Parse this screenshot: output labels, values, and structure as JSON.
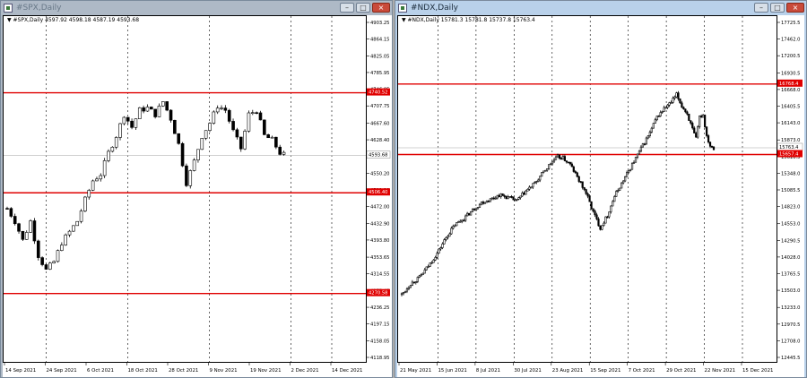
{
  "windows": [
    {
      "title": "#SPX,Daily",
      "active": false,
      "header": "#SPX,Daily  4597.92 4598.18 4587.19 4593.68",
      "buttons": {
        "minimize": "–",
        "maximize": "□",
        "close": "×"
      },
      "colors": {
        "level_line": "#e00000",
        "price_line": "#c0c0c0",
        "grid": "#000000"
      },
      "price_levels": [
        {
          "price": 4740.52,
          "label": "4740.52"
        },
        {
          "price": 4506.4,
          "label": "4506.40"
        },
        {
          "price": 4270.58,
          "label": "4270.58"
        }
      ],
      "current_price": {
        "price": 4593.68,
        "label": "4593.68"
      },
      "y_ticks": [
        {
          "price": 4903.25,
          "label": "4903.25"
        },
        {
          "price": 4864.15,
          "label": "4864.15"
        },
        {
          "price": 4825.05,
          "label": "4825.05"
        },
        {
          "price": 4785.95,
          "label": "4785.95"
        },
        {
          "price": 4746.85,
          "label": "4746.85"
        },
        {
          "price": 4707.75,
          "label": "4707.75"
        },
        {
          "price": 4667.6,
          "label": "4667.60"
        },
        {
          "price": 4628.4,
          "label": "4628.40"
        },
        {
          "price": 4589.3,
          "label": "4589.30"
        },
        {
          "price": 4550.2,
          "label": "4550.20"
        },
        {
          "price": 4511.1,
          "label": "4511.10"
        },
        {
          "price": 4472.0,
          "label": "4472.00"
        },
        {
          "price": 4432.9,
          "label": "4432.90"
        },
        {
          "price": 4393.8,
          "label": "4393.80"
        },
        {
          "price": 4353.65,
          "label": "4353.65"
        },
        {
          "price": 4314.55,
          "label": "4314.55"
        },
        {
          "price": 4275.45,
          "label": "4275.45"
        },
        {
          "price": 4236.25,
          "label": "4236.25"
        },
        {
          "price": 4197.15,
          "label": "4197.15"
        },
        {
          "price": 4158.05,
          "label": "4158.05"
        },
        {
          "price": 4118.95,
          "label": "4118.95"
        }
      ],
      "x_labels": [
        "14 Sep 2021",
        "24 Sep 2021",
        "6 Oct 2021",
        "18 Oct 2021",
        "28 Oct 2021",
        "9 Nov 2021",
        "19 Nov 2021",
        "2 Dec 2021",
        "14 Dec 2021"
      ],
      "x_grid_dates": [
        "24 Sep 2021",
        "18 Oct 2021",
        "9 Nov 2021",
        "2 Dec 2021",
        "24 Dec 2021"
      ],
      "chart_data": {
        "type": "candlestick",
        "symbol": "#SPX",
        "timeframe": "Daily",
        "ylim": [
          4118.95,
          4903.25
        ],
        "x": [
          "13 Sep 2021",
          "22 Dec 2021"
        ],
        "bars": 71,
        "waypoints": [
          [
            0,
            4470
          ],
          [
            3,
            4440
          ],
          [
            6,
            4395
          ],
          [
            9,
            4440
          ],
          [
            12,
            4360
          ],
          [
            15,
            4325
          ],
          [
            18,
            4345
          ],
          [
            21,
            4390
          ],
          [
            24,
            4415
          ],
          [
            27,
            4440
          ],
          [
            30,
            4490
          ],
          [
            33,
            4535
          ],
          [
            36,
            4550
          ],
          [
            39,
            4600
          ],
          [
            42,
            4640
          ],
          [
            45,
            4690
          ],
          [
            48,
            4660
          ],
          [
            51,
            4700
          ],
          [
            54,
            4705
          ],
          [
            57,
            4690
          ],
          [
            60,
            4720
          ],
          [
            63,
            4680
          ],
          [
            66,
            4620
          ],
          [
            69,
            4530
          ],
          [
            72,
            4580
          ],
          [
            75,
            4640
          ],
          [
            78,
            4670
          ],
          [
            81,
            4710
          ],
          [
            84,
            4700
          ],
          [
            87,
            4650
          ],
          [
            90,
            4610
          ],
          [
            93,
            4690
          ],
          [
            96,
            4700
          ],
          [
            99,
            4640
          ],
          [
            102,
            4630
          ],
          [
            105,
            4600
          ],
          [
            107,
            4593.68
          ]
        ]
      }
    },
    {
      "title": "#NDX,Daily",
      "active": true,
      "header": "#NDX,Daily  15781.3 15781.8 15737.8 15763.4",
      "buttons": {
        "minimize": "–",
        "maximize": "□",
        "close": "×"
      },
      "colors": {
        "level_line": "#e00000",
        "price_line": "#c0c0c0",
        "grid": "#000000"
      },
      "price_levels": [
        {
          "price": 16768.4,
          "label": "16768.4"
        },
        {
          "price": 15657.4,
          "label": "15657.4"
        }
      ],
      "current_price": {
        "price": 15763.4,
        "label": "15763.4"
      },
      "y_ticks": [
        {
          "price": 17725.5,
          "label": "17725.5"
        },
        {
          "price": 17462.0,
          "label": "17462.0"
        },
        {
          "price": 17200.5,
          "label": "17200.5"
        },
        {
          "price": 16930.5,
          "label": "16930.5"
        },
        {
          "price": 16668.0,
          "label": "16668.0"
        },
        {
          "price": 16405.5,
          "label": "16405.5"
        },
        {
          "price": 16143.0,
          "label": "16143.0"
        },
        {
          "price": 15873.0,
          "label": "15873.0"
        },
        {
          "price": 15610.5,
          "label": "15610.5"
        },
        {
          "price": 15348.0,
          "label": "15348.0"
        },
        {
          "price": 15085.5,
          "label": "15085.5"
        },
        {
          "price": 14823.0,
          "label": "14823.0"
        },
        {
          "price": 14553.0,
          "label": "14553.0"
        },
        {
          "price": 14290.5,
          "label": "14290.5"
        },
        {
          "price": 14028.0,
          "label": "14028.0"
        },
        {
          "price": 13765.5,
          "label": "13765.5"
        },
        {
          "price": 13503.0,
          "label": "13503.0"
        },
        {
          "price": 13233.0,
          "label": "13233.0"
        },
        {
          "price": 12970.5,
          "label": "12970.5"
        },
        {
          "price": 12708.0,
          "label": "12708.0"
        },
        {
          "price": 12445.5,
          "label": "12445.5"
        }
      ],
      "x_labels": [
        "21 May 2021",
        "15 Jun 2021",
        "8 Jul 2021",
        "30 Jul 2021",
        "23 Aug 2021",
        "15 Sep 2021",
        "7 Oct 2021",
        "29 Oct 2021",
        "22 Nov 2021",
        "15 Dec 2021"
      ],
      "x_grid_dates": [
        "15 Jun 2021",
        "8 Jul 2021",
        "30 Jul 2021",
        "23 Aug 2021",
        "15 Sep 2021",
        "7 Oct 2021",
        "29 Oct 2021",
        "22 Nov 2021",
        "15 Dec 2021"
      ],
      "chart_data": {
        "type": "candlestick",
        "symbol": "#NDX",
        "timeframe": "Daily",
        "ylim": [
          12445.5,
          17725.5
        ],
        "x": [
          "19 May 2021",
          "22 Dec 2021"
        ],
        "bars": 150,
        "waypoints": [
          [
            0,
            13450
          ],
          [
            5,
            13620
          ],
          [
            10,
            13720
          ],
          [
            15,
            13900
          ],
          [
            20,
            14100
          ],
          [
            25,
            14350
          ],
          [
            30,
            14550
          ],
          [
            35,
            14650
          ],
          [
            40,
            14780
          ],
          [
            45,
            14900
          ],
          [
            50,
            14950
          ],
          [
            55,
            15020
          ],
          [
            60,
            14980
          ],
          [
            65,
            14930
          ],
          [
            70,
            15080
          ],
          [
            75,
            15200
          ],
          [
            80,
            15380
          ],
          [
            85,
            15550
          ],
          [
            88,
            15620
          ],
          [
            91,
            15600
          ],
          [
            95,
            15500
          ],
          [
            100,
            15250
          ],
          [
            104,
            15050
          ],
          [
            108,
            14750
          ],
          [
            112,
            14500
          ],
          [
            116,
            14700
          ],
          [
            120,
            15000
          ],
          [
            124,
            15200
          ],
          [
            128,
            15400
          ],
          [
            132,
            15600
          ],
          [
            136,
            15800
          ],
          [
            140,
            16000
          ],
          [
            144,
            16250
          ],
          [
            148,
            16380
          ],
          [
            152,
            16480
          ],
          [
            155,
            16600
          ],
          [
            158,
            16420
          ],
          [
            161,
            16300
          ],
          [
            164,
            16050
          ],
          [
            166,
            15900
          ],
          [
            168,
            16250
          ],
          [
            170,
            16280
          ],
          [
            172,
            15950
          ],
          [
            174,
            15800
          ],
          [
            176,
            15763.4
          ]
        ]
      }
    }
  ]
}
